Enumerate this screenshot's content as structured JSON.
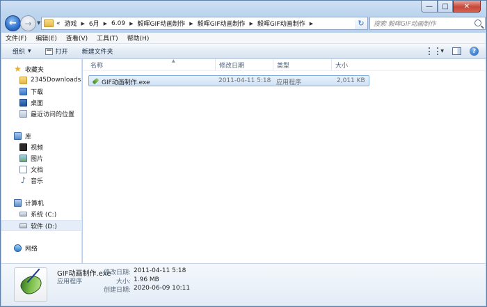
{
  "titlebar": {
    "minimize": "—",
    "maximize": "□",
    "close": "✕"
  },
  "nav": {
    "back_glyph": "←",
    "forward_glyph": "→",
    "refresh_glyph": "↻",
    "breadcrumbs": [
      "«",
      "游戏",
      "6月",
      "6.09",
      "毅晖GIF动画制作",
      "毅晖GIF动画制作",
      "毅晖GIF动画制作"
    ],
    "search_placeholder": "搜索 毅晖GIF动画制作"
  },
  "menu": [
    "文件(F)",
    "编辑(E)",
    "查看(V)",
    "工具(T)",
    "帮助(H)"
  ],
  "commands": {
    "organize": "组织",
    "open": "打开",
    "new_folder": "新建文件夹",
    "help": "?"
  },
  "sidebar": {
    "favorites": {
      "label": "收藏夹",
      "items": [
        "2345Downloads",
        "下载",
        "桌面",
        "最近访问的位置"
      ]
    },
    "libraries": {
      "label": "库",
      "items": [
        "视频",
        "图片",
        "文档",
        "音乐"
      ]
    },
    "computer": {
      "label": "计算机",
      "items": [
        "系统 (C:)",
        "软件 (D:)"
      ]
    },
    "network": {
      "label": "网络"
    }
  },
  "columns": {
    "name": "名称",
    "modified": "修改日期",
    "type": "类型",
    "size": "大小"
  },
  "files": [
    {
      "name": "GIF动画制作.exe",
      "modified": "2011-04-11 5:18",
      "type": "应用程序",
      "size": "2,011 KB"
    }
  ],
  "details": {
    "filename": "GIF动画制作.exe",
    "filetype": "应用程序",
    "modified_label": "修改日期:",
    "modified_value": "2011-04-11 5:18",
    "size_label": "大小:",
    "size_value": "1.96 MB",
    "created_label": "创建日期:",
    "created_value": "2020-06-09 10:11"
  }
}
